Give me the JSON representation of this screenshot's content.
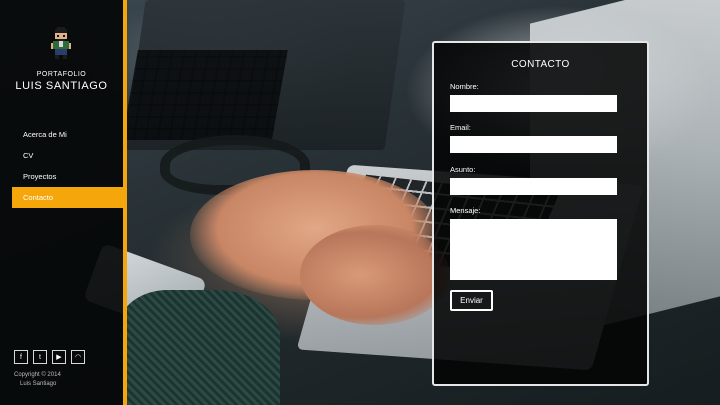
{
  "brand": {
    "subtitle": "PORTAFOLIO",
    "name": "LUIS SANTIAGO"
  },
  "nav": {
    "items": [
      {
        "label": "Acerca de Mi"
      },
      {
        "label": "CV"
      },
      {
        "label": "Proyectos"
      },
      {
        "label": "Contacto",
        "active": true
      }
    ]
  },
  "social": {
    "items": [
      {
        "icon": "facebook-icon",
        "glyph": "f"
      },
      {
        "icon": "twitter-icon",
        "glyph": "t"
      },
      {
        "icon": "youtube-icon",
        "glyph": "▶"
      },
      {
        "icon": "rss-icon",
        "glyph": "◠"
      }
    ]
  },
  "footer": {
    "copyright_line1": "Copyright © 2014",
    "copyright_line2": "Luis Santiago"
  },
  "contact": {
    "title": "CONTACTO",
    "name_label": "Nombre:",
    "name_value": "",
    "email_label": "Email:",
    "email_value": "",
    "subject_label": "Asunto:",
    "subject_value": "",
    "message_label": "Mensaje:",
    "message_value": "",
    "submit_label": "Enviar"
  },
  "colors": {
    "accent": "#f5a60a",
    "sidebar_bg": "#050708",
    "card_border": "#e6e6e6"
  }
}
